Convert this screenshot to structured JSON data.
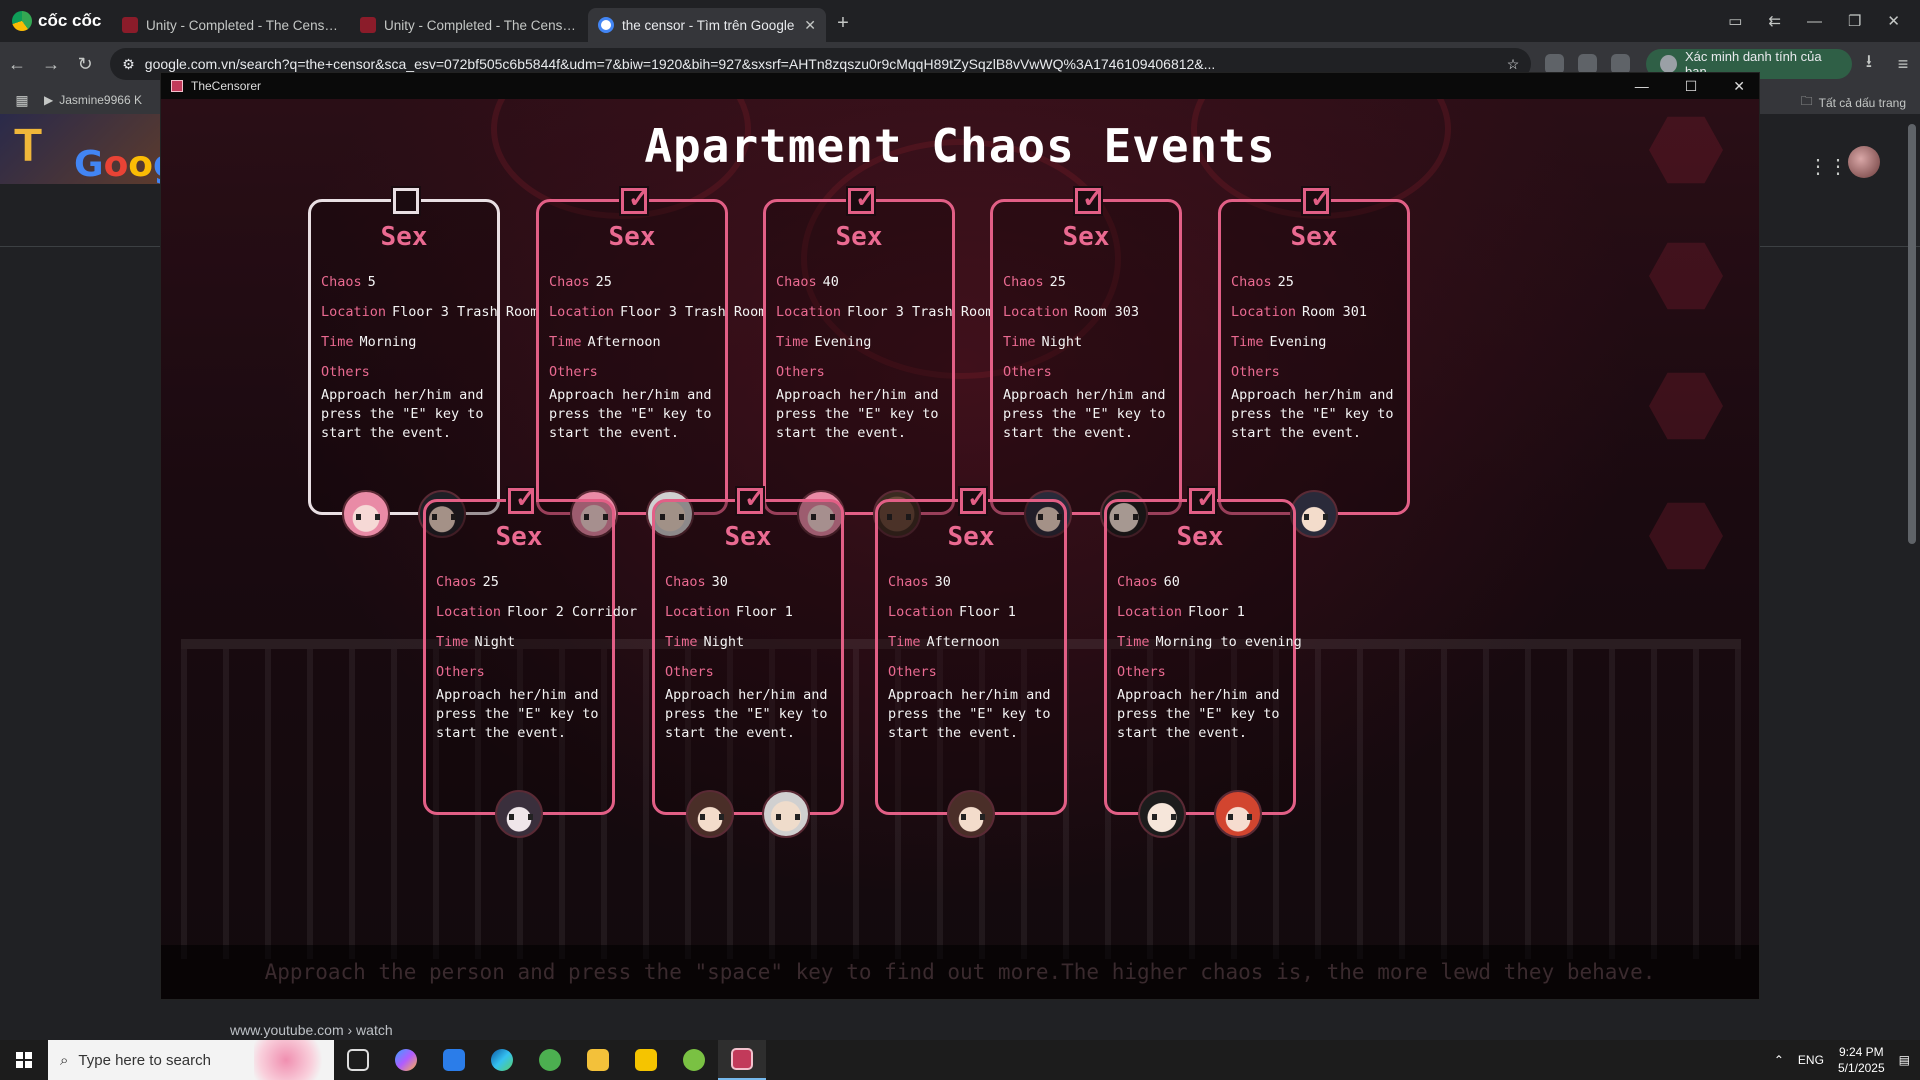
{
  "browser": {
    "brand": "cốc cốc",
    "tabs": [
      {
        "title": "Unity - Completed - The Censor [v",
        "active": false
      },
      {
        "title": "Unity - Completed - The Censor [v",
        "active": false
      },
      {
        "title": "the censor - Tìm trên Google",
        "active": true
      }
    ],
    "url": "google.com.vn/search?q=the+censor&sca_esv=072bf505c6b5844f&udm=7&biw=1920&bih=927&sxsrf=AHTn8zqszu0r9cMqqH89tZySqzlB8vVwWQ%3A1746109406812&...",
    "profile_label": "Xác minh danh tính của bạn",
    "bookmark_1": "Jasmine9966 K",
    "bookmarks_all": "Tất cả dấu trang",
    "youtube_hint": "www.youtube.com › watch"
  },
  "game": {
    "window_title": "TheCensorer",
    "screen_title": "Apartment Chaos Events",
    "hint": "Approach the person and press the \"space\" key to find out more.The higher chaos is, the more lewd they behave.",
    "labels": {
      "chaos": "Chaos",
      "location": "Location",
      "time": "Time",
      "others": "Others"
    },
    "cards": [
      {
        "title": "Sex",
        "checked": false,
        "chaos": "5",
        "location": "Floor 3 Trash Room",
        "time": "Morning",
        "desc": "Approach her/him and press the \"E\" key to start the event.",
        "faces": [
          "pink-hair-girl",
          "dark-hair-boy"
        ]
      },
      {
        "title": "Sex",
        "checked": true,
        "chaos": "25",
        "location": "Floor 3 Trash Room",
        "time": "Afternoon",
        "desc": "Approach her/him and press the \"E\" key to start the event.",
        "faces": [
          "pink-hair-girl",
          "old-man"
        ]
      },
      {
        "title": "Sex",
        "checked": true,
        "chaos": "40",
        "location": "Floor 3 Trash Room",
        "time": "Evening",
        "desc": "Approach her/him and press the \"E\" key to start the event.",
        "faces": [
          "pink-hair-girl",
          "bald-man"
        ]
      },
      {
        "title": "Sex",
        "checked": true,
        "chaos": "25",
        "location": "Room 303",
        "time": "Night",
        "desc": "Approach her/him and press the \"E\" key to start the event.",
        "faces": [
          "dark-hair-girl",
          "glasses-man"
        ]
      },
      {
        "title": "Sex",
        "checked": true,
        "chaos": "25",
        "location": "Room 301",
        "time": "Evening",
        "desc": "Approach her/him and press the \"E\" key to start the event.",
        "faces": [
          "dark-hair-girl"
        ]
      },
      {
        "title": "Sex",
        "checked": true,
        "chaos": "25",
        "location": "Floor 2 Corridor",
        "time": "Night",
        "desc": "Approach her/him and press the \"E\" key to start the event.",
        "faces": [
          "masked-girl"
        ]
      },
      {
        "title": "Sex",
        "checked": true,
        "chaos": "30",
        "location": "Floor 1",
        "time": "Night",
        "desc": "Approach her/him and press the \"E\" key to start the event.",
        "faces": [
          "brown-hair-girl",
          "old-man"
        ]
      },
      {
        "title": "Sex",
        "checked": true,
        "chaos": "30",
        "location": "Floor 1",
        "time": "Afternoon",
        "desc": "Approach her/him and press the \"E\" key to start the event.",
        "faces": [
          "brown-hair-girl"
        ]
      },
      {
        "title": "Sex",
        "checked": true,
        "chaos": "60",
        "location": "Floor 1",
        "time": "Morning to evening",
        "desc": "Approach her/him and press the \"E\" key to start the event.",
        "faces": [
          "glasses-man",
          "red-hair-girl"
        ]
      }
    ]
  },
  "taskbar": {
    "search_placeholder": "Type here to search",
    "lang": "ENG",
    "time": "9:24 PM",
    "date": "5/1/2025"
  },
  "colors": {
    "accent_pink": "#ea6a91",
    "card_border": "#e25f86",
    "unchecked_border": "#e9dfe3"
  }
}
